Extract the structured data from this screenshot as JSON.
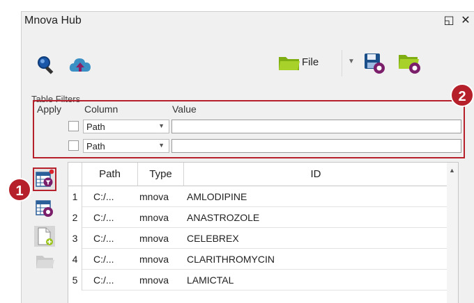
{
  "window": {
    "title": "Mnova Hub",
    "float_icon": "float-icon",
    "close_icon": "close-icon"
  },
  "toolbar": {
    "file_label": "File",
    "icons": [
      "search-icon",
      "cloud-upload-icon",
      "folder-icon",
      "chevron-down-icon",
      "save-settings-icon",
      "folder-settings-icon"
    ]
  },
  "filters": {
    "group_label": "Table Filters",
    "headers": {
      "apply": "Apply",
      "column": "Column",
      "value": "Value"
    },
    "rows": [
      {
        "checked": false,
        "column": "Path",
        "value": ""
      },
      {
        "checked": false,
        "column": "Path",
        "value": ""
      }
    ]
  },
  "grid": {
    "columns": [
      "Path",
      "Type",
      "ID"
    ],
    "rows": [
      {
        "num": "1",
        "path": "C:/...",
        "type": "mnova",
        "id": "AMLODIPINE"
      },
      {
        "num": "2",
        "path": "C:/...",
        "type": "mnova",
        "id": "ANASTROZOLE"
      },
      {
        "num": "3",
        "path": "C:/...",
        "type": "mnova",
        "id": "CELEBREX"
      },
      {
        "num": "4",
        "path": "C:/...",
        "type": "mnova",
        "id": "CLARITHROMYCIN"
      },
      {
        "num": "5",
        "path": "C:/...",
        "type": "mnova",
        "id": "LAMICTAL"
      }
    ]
  },
  "side_icons": [
    "table-filter-icon",
    "table-settings-icon",
    "add-document-icon",
    "folder-icon"
  ],
  "callouts": [
    "1",
    "2"
  ],
  "colors": {
    "accent_red": "#b5202a",
    "folder_green": "#9ac41b",
    "icon_purple": "#7b1f6b"
  }
}
